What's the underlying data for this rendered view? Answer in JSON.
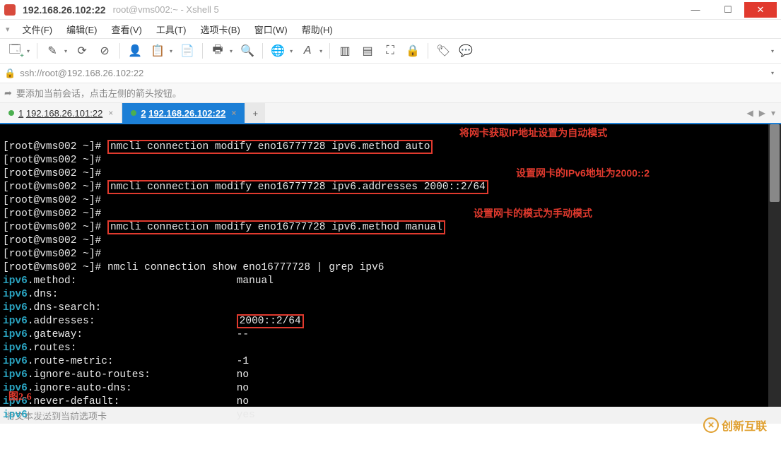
{
  "titlebar": {
    "main": "192.168.26.102:22",
    "sub": "root@vms002:~ - Xshell 5"
  },
  "menu": {
    "file": "文件(F)",
    "edit": "编辑(E)",
    "view": "查看(V)",
    "tools": "工具(T)",
    "tabs": "选项卡(B)",
    "window": "窗口(W)",
    "help": "帮助(H)"
  },
  "address": {
    "url": "ssh://root@192.168.26.102:22"
  },
  "hint": {
    "text": "要添加当前会话，点击左侧的箭头按钮。"
  },
  "tabs": {
    "t1": {
      "num": "1",
      "label": "192.168.26.101:22"
    },
    "t2": {
      "num": "2",
      "label": "192.168.26.102:22"
    },
    "add": "+"
  },
  "terminal": {
    "prompt": "[root@vms002 ~]#",
    "cmd1": "nmcli connection modify eno16777728 ipv6.method auto",
    "annot1": "将网卡获取IP地址设置为自动模式",
    "cmd2": "nmcli connection modify eno16777728 ipv6.addresses 2000::2/64",
    "annot2": "设置网卡的IPv6地址为2000::2",
    "cmd3": "nmcli connection modify eno16777728 ipv6.method manual",
    "annot3": "设置网卡的模式为手动模式",
    "cmd4": "nmcli connection show eno16777728 | grep ipv6",
    "rows": {
      "method": {
        "k": "ipv6",
        "suffix": ".method:",
        "v": "manual"
      },
      "dns": {
        "k": "ipv6",
        "suffix": ".dns:",
        "v": ""
      },
      "dns_search": {
        "k": "ipv6",
        "suffix": ".dns-search:",
        "v": ""
      },
      "addresses": {
        "k": "ipv6",
        "suffix": ".addresses:",
        "v": "2000::2/64"
      },
      "gateway": {
        "k": "ipv6",
        "suffix": ".gateway:",
        "v": "--"
      },
      "routes": {
        "k": "ipv6",
        "suffix": ".routes:",
        "v": ""
      },
      "route_metric": {
        "k": "ipv6",
        "suffix": ".route-metric:",
        "v": "-1"
      },
      "ign_routes": {
        "k": "ipv6",
        "suffix": ".ignore-auto-routes:",
        "v": "no"
      },
      "ign_dns": {
        "k": "ipv6",
        "suffix": ".ignore-auto-dns:",
        "v": "no"
      },
      "never_default": {
        "k": "ipv6",
        "suffix": ".never-default:",
        "v": "no"
      },
      "may_fail": {
        "k": "ipv6",
        "suffix": ".may-fail:",
        "v": "yes"
      }
    },
    "figure": "图2-6"
  },
  "status": {
    "text": "将文本发送到当前选项卡"
  },
  "watermark": {
    "text": "创新互联"
  }
}
